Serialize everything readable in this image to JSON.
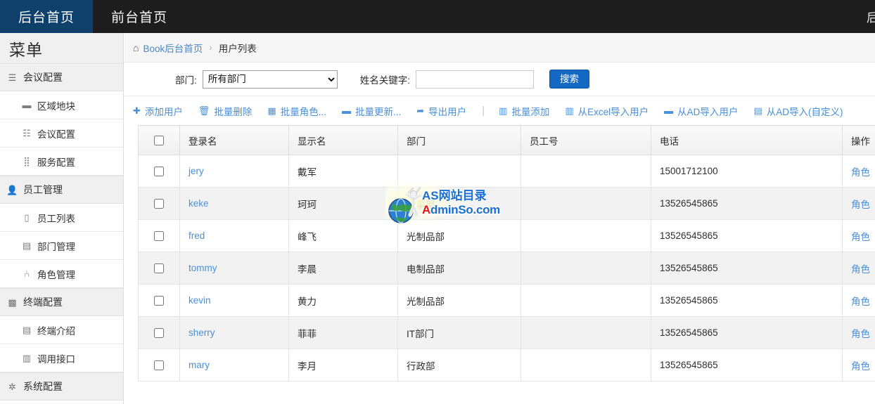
{
  "navbar": {
    "tabs": [
      {
        "label": "后台首页",
        "active": true
      },
      {
        "label": "前台首页",
        "active": false
      }
    ],
    "right_partial": "后"
  },
  "sidebar": {
    "title": "菜单",
    "groups": [
      {
        "label": "会议配置",
        "icon": "bars-icon",
        "glyph": "☰",
        "items": [
          {
            "label": "区域地块",
            "icon": "table-icon",
            "glyph": "▬"
          },
          {
            "label": "会议配置",
            "icon": "list-icon",
            "glyph": "☷"
          },
          {
            "label": "服务配置",
            "icon": "grid-icon",
            "glyph": "⣿"
          }
        ]
      },
      {
        "label": "员工管理",
        "icon": "user-icon",
        "glyph": "👤",
        "items": [
          {
            "label": "员工列表",
            "icon": "file-icon",
            "glyph": "▯"
          },
          {
            "label": "部门管理",
            "icon": "book-icon",
            "glyph": "▤"
          },
          {
            "label": "角色管理",
            "icon": "columns-icon",
            "glyph": "⑃"
          }
        ]
      },
      {
        "label": "终端配置",
        "icon": "film-icon",
        "glyph": "▩",
        "items": [
          {
            "label": "终端介绍",
            "icon": "note-icon",
            "glyph": "▤"
          },
          {
            "label": "调用接口",
            "icon": "tasks-icon",
            "glyph": "▥"
          }
        ]
      },
      {
        "label": "系统配置",
        "icon": "gear-icon",
        "glyph": "✱",
        "items": []
      }
    ]
  },
  "breadcrumb": {
    "home_icon": "home-icon",
    "home_glyph": "⌂",
    "link": "Book后台首页",
    "separator": "›",
    "current": "用户列表"
  },
  "filter": {
    "dept_label": "部门:",
    "dept_value": "所有部门",
    "dept_options": [
      "所有部门"
    ],
    "keyword_label": "姓名关键字:",
    "keyword_value": "",
    "keyword_placeholder": "",
    "search_label": "搜索",
    "search_color": "#1268c3"
  },
  "toolbar": {
    "left": [
      {
        "label": "添加用户",
        "icon": "plus-icon",
        "glyph": "✚"
      },
      {
        "label": "批量删除",
        "icon": "trash-icon",
        "glyph": "🗑"
      },
      {
        "label": "批量角色...",
        "icon": "calendar-icon",
        "glyph": "▦"
      },
      {
        "label": "批量更新...",
        "icon": "window-icon",
        "glyph": "▬"
      },
      {
        "label": "导出用户",
        "icon": "share-icon",
        "glyph": "➦"
      }
    ],
    "separator": "|",
    "right": [
      {
        "label": "批量添加",
        "icon": "tasks-icon",
        "glyph": "▥"
      },
      {
        "label": "从Excel导入用户",
        "icon": "tasks-icon",
        "glyph": "▥"
      },
      {
        "label": "从AD导入用户",
        "icon": "window-icon",
        "glyph": "▬"
      },
      {
        "label": "从AD导入(自定义)",
        "icon": "book-icon",
        "glyph": "▤"
      }
    ],
    "link_color": "#4a90d9"
  },
  "table": {
    "columns": [
      "",
      "登录名",
      "显示名",
      "部门",
      "员工号",
      "电话",
      "操作"
    ],
    "select_all": false,
    "rows": [
      {
        "checked": false,
        "login": "jery",
        "display": "戴军",
        "dept": "",
        "emp": "",
        "tel": "15001712100",
        "action": "角色"
      },
      {
        "checked": false,
        "login": "keke",
        "display": "珂珂",
        "dept": "人事部",
        "emp": "",
        "tel": "13526545865",
        "action": "角色"
      },
      {
        "checked": false,
        "login": "fred",
        "display": "峰飞",
        "dept": "光制品部",
        "emp": "",
        "tel": "13526545865",
        "action": "角色"
      },
      {
        "checked": false,
        "login": "tommy",
        "display": "李晨",
        "dept": "电制品部",
        "emp": "",
        "tel": "13526545865",
        "action": "角色"
      },
      {
        "checked": false,
        "login": "kevin",
        "display": "黄力",
        "dept": "光制品部",
        "emp": "",
        "tel": "13526545865",
        "action": "角色"
      },
      {
        "checked": false,
        "login": "sherry",
        "display": "菲菲",
        "dept": "IT部门",
        "emp": "",
        "tel": "13526545865",
        "action": "角色"
      },
      {
        "checked": false,
        "login": "mary",
        "display": "李月",
        "dept": "行政部",
        "emp": "",
        "tel": "13526545865",
        "action": "角色"
      }
    ]
  },
  "watermark": {
    "line1": "AS网站目录",
    "line2_first": "A",
    "line2_rest": "dminSo.com",
    "icon": "globe-icon",
    "color_blue": "#1a6fd4",
    "color_red": "#e21313"
  }
}
